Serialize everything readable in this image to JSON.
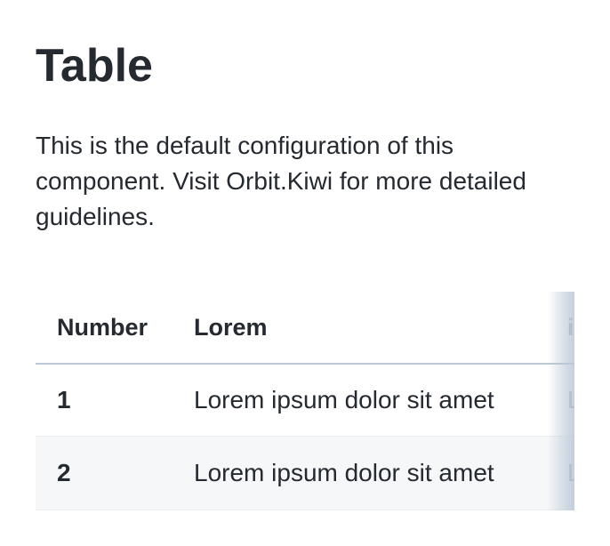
{
  "page": {
    "title": "Table",
    "description": "This is the default configuration of this component. Visit Orbit.Kiwi for more detailed guidelines."
  },
  "table": {
    "columns": [
      "Number",
      "Lorem",
      "ipsum"
    ],
    "rows": [
      {
        "number": "1",
        "lorem": "Lorem ipsum dolor sit amet",
        "extra": "Lorem"
      },
      {
        "number": "2",
        "lorem": "Lorem ipsum dolor sit amet",
        "extra": "Lorem"
      }
    ]
  },
  "colors": {
    "text": "#252a31",
    "header_border": "#bac7d5",
    "row_border": "#e8edf1",
    "striped_row": "#f5f7f9"
  }
}
